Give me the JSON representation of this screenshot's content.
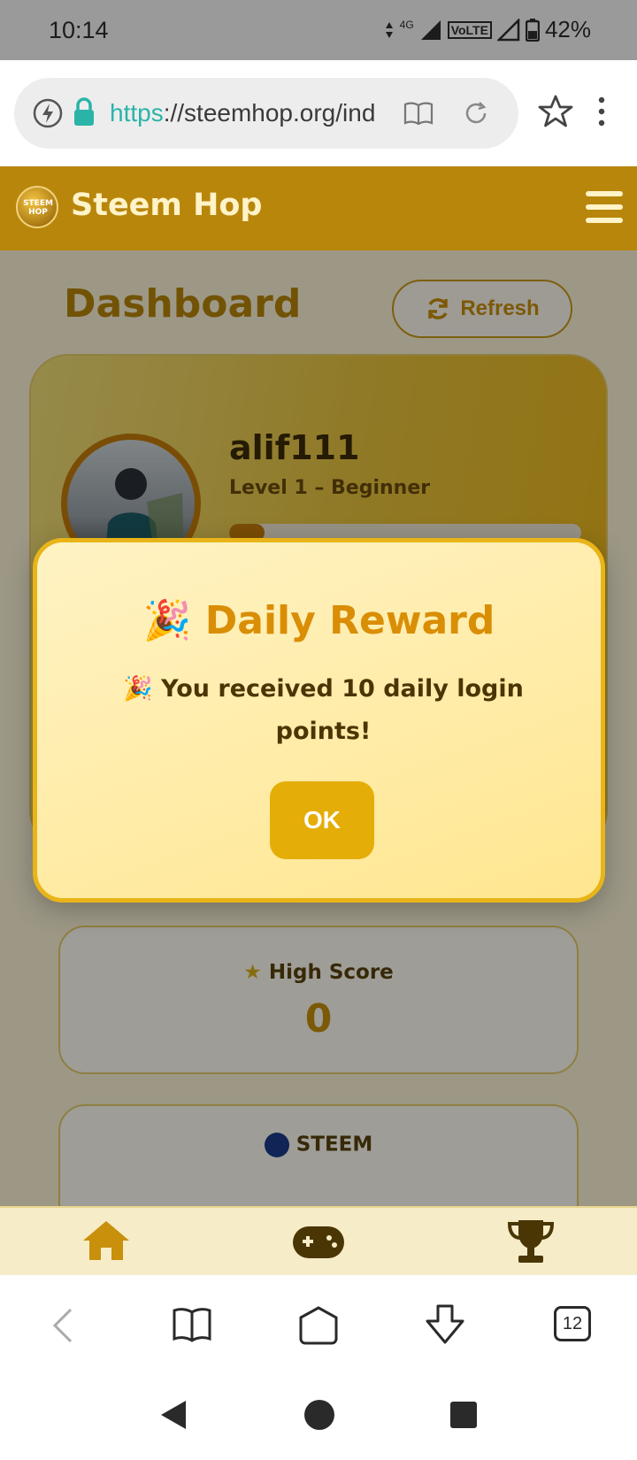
{
  "status_bar": {
    "time": "10:14",
    "network_label": "4G",
    "volte_label": "VoLTE",
    "battery_percent": "42%"
  },
  "browser": {
    "url_scheme": "https",
    "url_rest": "://steemhop.org/ind",
    "tab_count": "12"
  },
  "app": {
    "logo_text": "STEEM HOP",
    "brand": "Steem Hop",
    "page_title": "Dashboard",
    "refresh_label": "Refresh",
    "profile": {
      "username": "alif111",
      "level": "Level 1 – Beginner",
      "level_progress": 0.1
    },
    "stats": [
      {
        "label": "High Score",
        "value": "0",
        "icon": "star-icon"
      }
    ],
    "partial_card_label": "STEEM",
    "bottom_nav": [
      "home-icon",
      "gamepad-icon",
      "trophy-icon"
    ]
  },
  "modal": {
    "title": "🎉 Daily Reward",
    "message": "🎉 You received 10 daily login points!",
    "ok_label": "OK"
  },
  "colors": {
    "brand_dark": "#b8860b",
    "accent_gold": "#e5ad08",
    "modal_bg": "#fff3c4"
  }
}
